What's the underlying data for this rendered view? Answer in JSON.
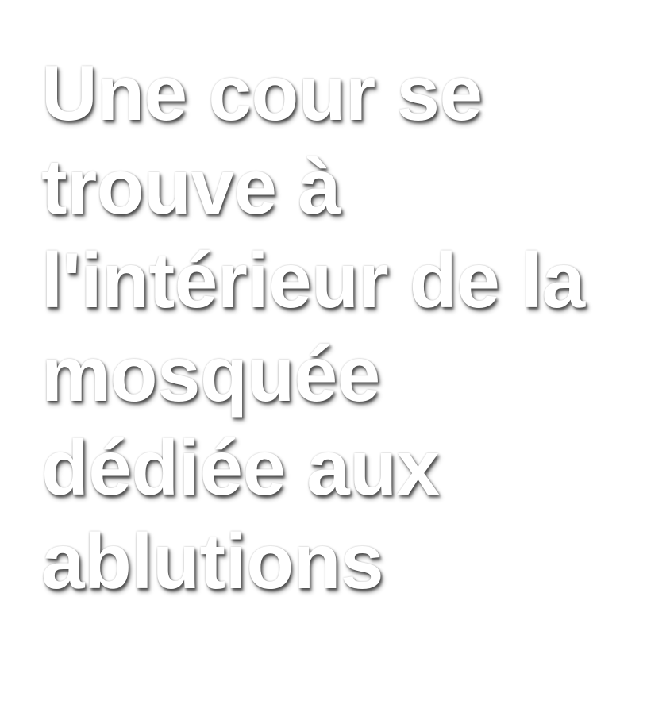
{
  "caption": {
    "lines": [
      "Une cour se",
      "trouve à",
      "l'intérieur de la",
      "mosquée",
      "dédiée aux",
      "ablutions"
    ]
  },
  "colors": {
    "background": "#ffffff",
    "text": "#ffffff",
    "shadow": "#000000"
  }
}
